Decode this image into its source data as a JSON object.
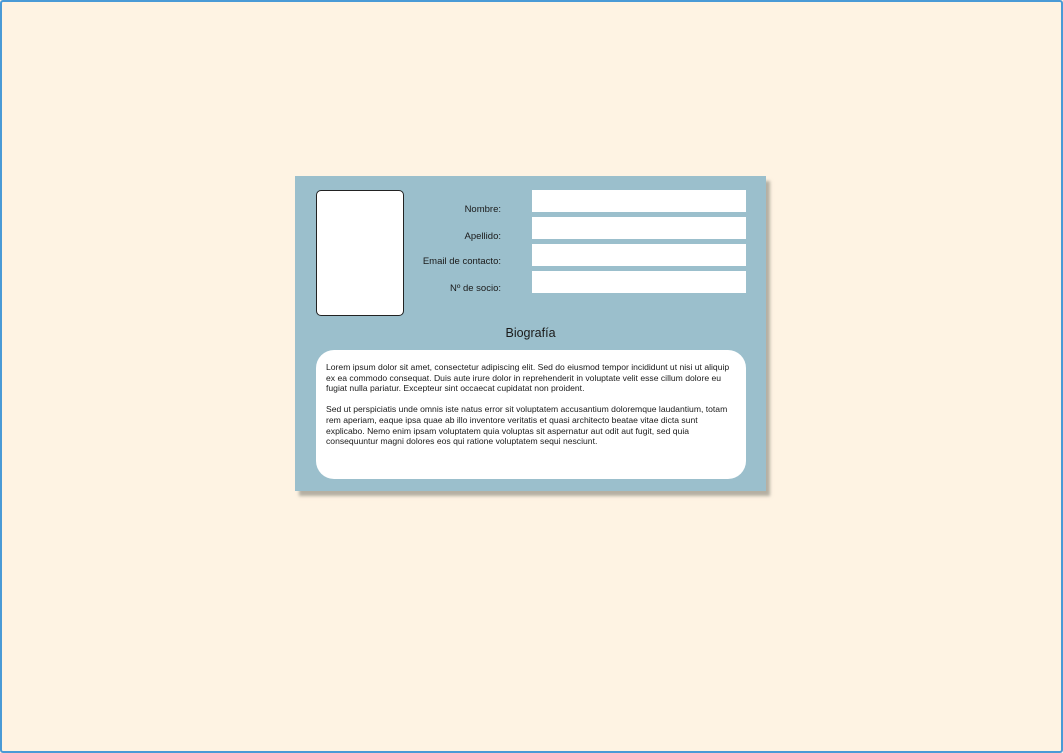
{
  "profile_card": {
    "fields": [
      {
        "label": "Nombre:",
        "value": ""
      },
      {
        "label": "Apellido:",
        "value": ""
      },
      {
        "label": "Email de contacto:",
        "value": ""
      },
      {
        "label": "Nº de socio:",
        "value": ""
      }
    ],
    "bio_title": "Biografía",
    "bio_paragraphs": [
      "Lorem ipsum dolor sit amet, consectetur adipiscing elit. Sed do eiusmod tempor incididunt ut nisi ut aliquip ex ea commodo consequat. Duis aute irure dolor in reprehenderit in voluptate velit esse cillum dolore eu fugiat nulla pariatur. Excepteur sint occaecat cupidatat non proident.",
      "Sed ut perspiciatis unde omnis iste natus error sit voluptatem accusantium doloremque laudantium, totam rem aperiam, eaque ipsa quae ab illo inventore veritatis et quasi architecto beatae vitae dicta sunt explicabo. Nemo enim ipsam voluptatem quia voluptas sit aspernatur aut odit aut fugit, sed quia consequuntur magni dolores eos qui ratione voluptatem sequi nesciunt."
    ]
  },
  "colors": {
    "page_background": "#fef3e3",
    "card_background": "#9bbfcc",
    "frame_border": "#4a9ad6"
  }
}
